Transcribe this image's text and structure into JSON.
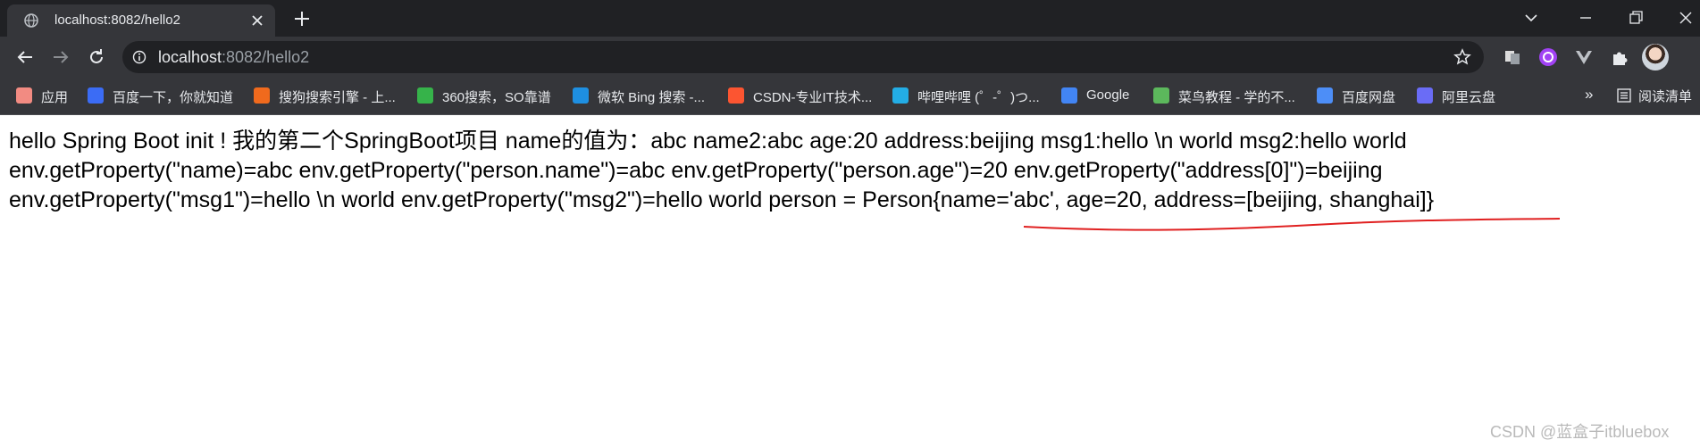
{
  "tab": {
    "title": "localhost:8082/hello2"
  },
  "address_bar": {
    "host": "localhost",
    "path": ":8082/hello2"
  },
  "bookmarks": [
    {
      "label": "应用",
      "icon": "apps-grid-icon",
      "color": "#f28b82"
    },
    {
      "label": "百度一下，你就知道",
      "icon": "baidu-icon",
      "color": "#3b6cf5"
    },
    {
      "label": "搜狗搜索引擎 - 上...",
      "icon": "sogou-icon",
      "color": "#f06a1d"
    },
    {
      "label": "360搜索，SO靠谱",
      "icon": "360-search-icon",
      "color": "#36b34a"
    },
    {
      "label": "微软 Bing 搜索 -...",
      "icon": "bing-icon",
      "color": "#1e8fe1"
    },
    {
      "label": "CSDN-专业IT技术...",
      "icon": "csdn-icon",
      "color": "#fc5531"
    },
    {
      "label": "哔哩哔哩 (゜-゜)つ...",
      "icon": "bilibili-icon",
      "color": "#23ade5"
    },
    {
      "label": "Google",
      "icon": "google-icon",
      "color": "#4285f4"
    },
    {
      "label": "菜鸟教程 - 学的不...",
      "icon": "runoob-icon",
      "color": "#5cb85c"
    },
    {
      "label": "百度网盘",
      "icon": "baidu-netdisk-icon",
      "color": "#4d8ef7"
    },
    {
      "label": "阿里云盘",
      "icon": "aliyun-drive-icon",
      "color": "#6a6cf6"
    }
  ],
  "bookmarks_overflow": "»",
  "reading_list": "阅读清单",
  "page": {
    "lines": [
      "hello Spring Boot init ! 我的第二个SpringBoot项目 name的值为：abc name2:abc age:20 address:beijing msg1:hello \\n world msg2:hello world",
      "env.getProperty(\"name)=abc env.getProperty(\"person.name\")=abc env.getProperty(\"person.age\")=20 env.getProperty(\"address[0]\")=beijing",
      "env.getProperty(\"msg1\")=hello \\n world env.getProperty(\"msg2\")=hello world person = Person{name='abc', age=20, address=[beijing, shanghai]}"
    ]
  },
  "watermark": "CSDN @蓝盒子itbluebox",
  "colors": {
    "tab_bg": "#35363a",
    "chrome_dark": "#202124",
    "annotation": "#e02020"
  }
}
